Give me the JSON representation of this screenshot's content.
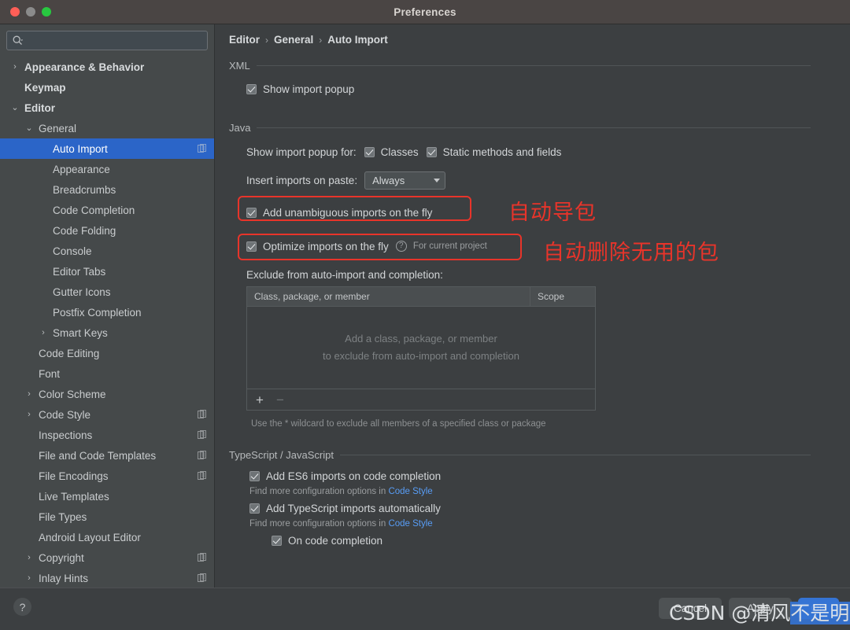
{
  "window": {
    "title": "Preferences",
    "traffic_lights": [
      "close-button",
      "minimize-button",
      "zoom-button"
    ]
  },
  "sidebar": {
    "search": {
      "value": "",
      "placeholder": ""
    },
    "items": [
      {
        "label": "Appearance & Behavior",
        "indent": 0,
        "arrow": "›",
        "bold": true,
        "selected": false,
        "doc": false
      },
      {
        "label": "Keymap",
        "indent": 0,
        "arrow": "",
        "bold": true,
        "selected": false,
        "doc": false
      },
      {
        "label": "Editor",
        "indent": 0,
        "arrow": "⌄",
        "bold": true,
        "selected": false,
        "doc": false
      },
      {
        "label": "General",
        "indent": 1,
        "arrow": "⌄",
        "bold": false,
        "selected": false,
        "doc": false
      },
      {
        "label": "Auto Import",
        "indent": 2,
        "arrow": "",
        "bold": false,
        "selected": true,
        "doc": true
      },
      {
        "label": "Appearance",
        "indent": 2,
        "arrow": "",
        "bold": false,
        "selected": false,
        "doc": false
      },
      {
        "label": "Breadcrumbs",
        "indent": 2,
        "arrow": "",
        "bold": false,
        "selected": false,
        "doc": false
      },
      {
        "label": "Code Completion",
        "indent": 2,
        "arrow": "",
        "bold": false,
        "selected": false,
        "doc": false
      },
      {
        "label": "Code Folding",
        "indent": 2,
        "arrow": "",
        "bold": false,
        "selected": false,
        "doc": false
      },
      {
        "label": "Console",
        "indent": 2,
        "arrow": "",
        "bold": false,
        "selected": false,
        "doc": false
      },
      {
        "label": "Editor Tabs",
        "indent": 2,
        "arrow": "",
        "bold": false,
        "selected": false,
        "doc": false
      },
      {
        "label": "Gutter Icons",
        "indent": 2,
        "arrow": "",
        "bold": false,
        "selected": false,
        "doc": false
      },
      {
        "label": "Postfix Completion",
        "indent": 2,
        "arrow": "",
        "bold": false,
        "selected": false,
        "doc": false
      },
      {
        "label": "Smart Keys",
        "indent": 2,
        "arrow": "›",
        "bold": false,
        "selected": false,
        "doc": false
      },
      {
        "label": "Code Editing",
        "indent": 1,
        "arrow": "",
        "bold": false,
        "selected": false,
        "doc": false
      },
      {
        "label": "Font",
        "indent": 1,
        "arrow": "",
        "bold": false,
        "selected": false,
        "doc": false
      },
      {
        "label": "Color Scheme",
        "indent": 1,
        "arrow": "›",
        "bold": false,
        "selected": false,
        "doc": false
      },
      {
        "label": "Code Style",
        "indent": 1,
        "arrow": "›",
        "bold": false,
        "selected": false,
        "doc": true
      },
      {
        "label": "Inspections",
        "indent": 1,
        "arrow": "",
        "bold": false,
        "selected": false,
        "doc": true
      },
      {
        "label": "File and Code Templates",
        "indent": 1,
        "arrow": "",
        "bold": false,
        "selected": false,
        "doc": true
      },
      {
        "label": "File Encodings",
        "indent": 1,
        "arrow": "",
        "bold": false,
        "selected": false,
        "doc": true
      },
      {
        "label": "Live Templates",
        "indent": 1,
        "arrow": "",
        "bold": false,
        "selected": false,
        "doc": false
      },
      {
        "label": "File Types",
        "indent": 1,
        "arrow": "",
        "bold": false,
        "selected": false,
        "doc": false
      },
      {
        "label": "Android Layout Editor",
        "indent": 1,
        "arrow": "",
        "bold": false,
        "selected": false,
        "doc": false
      },
      {
        "label": "Copyright",
        "indent": 1,
        "arrow": "›",
        "bold": false,
        "selected": false,
        "doc": true
      },
      {
        "label": "Inlay Hints",
        "indent": 1,
        "arrow": "›",
        "bold": false,
        "selected": false,
        "doc": true
      }
    ]
  },
  "breadcrumb": {
    "part1": "Editor",
    "part2": "General",
    "part3": "Auto Import",
    "sep": "›"
  },
  "sections": {
    "xml": {
      "title": "XML",
      "show_import_popup": {
        "label": "Show import popup",
        "checked": true
      }
    },
    "java": {
      "title": "Java",
      "show_import_popup_for_label": "Show import popup for:",
      "classes": {
        "label": "Classes",
        "checked": true
      },
      "static_methods": {
        "label": "Static methods and fields",
        "checked": true
      },
      "insert_imports_label": "Insert imports on paste:",
      "insert_imports_value": "Always",
      "add_unambiguous": {
        "label": "Add unambiguous imports on the fly",
        "checked": true
      },
      "optimize_imports": {
        "label": "Optimize imports on the fly",
        "checked": true,
        "scope_note": "For current project"
      },
      "exclude_label": "Exclude from auto-import and completion:",
      "table": {
        "columns": [
          "Class, package, or member",
          "Scope"
        ],
        "rows": [],
        "empty_line1": "Add a class, package, or member",
        "empty_line2": "to exclude from auto-import and completion",
        "add_button": "+",
        "remove_button": "−"
      },
      "hint": "Use the * wildcard to exclude all members of a specified class or package"
    },
    "typescript": {
      "title": "TypeScript / JavaScript",
      "add_es6": {
        "label": "Add ES6 imports on code completion",
        "checked": true
      },
      "note1_prefix": "Find more configuration options in ",
      "note1_link": "Code Style",
      "add_ts": {
        "label": "Add TypeScript imports automatically",
        "checked": true
      },
      "note2_prefix": "Find more configuration options in ",
      "note2_link": "Code Style",
      "on_code_completion": {
        "label": "On code completion",
        "checked": true
      }
    }
  },
  "annotations": {
    "note1": "自动导包",
    "note2": "自动删除无用的包",
    "accent_color": "#e8342a"
  },
  "footer": {
    "help": "?",
    "cancel": "Cancel",
    "apply": "Apply",
    "ok": "OK"
  },
  "watermark": {
    "prefix": "CSDN @清风",
    "highlight": "不是明月"
  }
}
